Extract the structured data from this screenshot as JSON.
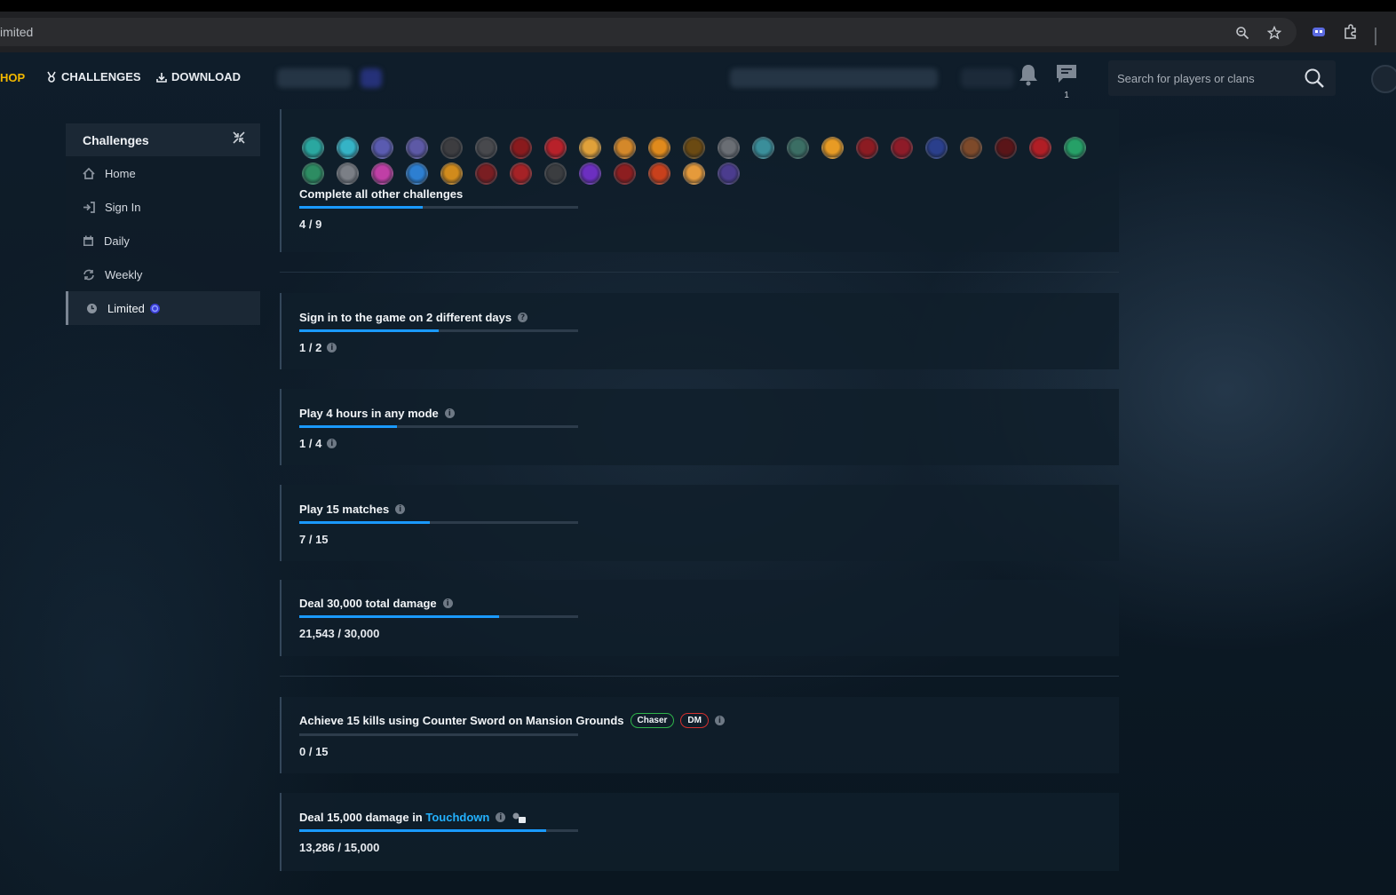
{
  "browser": {
    "url_fragment": "imited"
  },
  "nav": {
    "shop": "HOP",
    "challenges": "CHALLENGES",
    "download": "DOWNLOAD",
    "message_count": "1",
    "search_placeholder": "Search for players or clans"
  },
  "sidebar": {
    "title": "Challenges",
    "items": [
      {
        "label": "Home",
        "icon": "home-icon"
      },
      {
        "label": "Sign In",
        "icon": "sign-in-icon"
      },
      {
        "label": "Daily",
        "icon": "calendar-icon"
      },
      {
        "label": "Weekly",
        "icon": "refresh-icon"
      },
      {
        "label": "Limited",
        "icon": "clock-icon",
        "active": true
      }
    ]
  },
  "colors": {
    "accent": "#1a9aff",
    "shop": "#f2b800",
    "chaser": "#2fb44a",
    "dm": "#d3302e",
    "link": "#23b2ff"
  },
  "rewards": {
    "colors": [
      "#2aa7a0",
      "#35b3c6",
      "#5a5bb0",
      "#5d59a6",
      "#3d3d40",
      "#48494d",
      "#8a1a1d",
      "#b8212a",
      "#e0a13a",
      "#d4882a",
      "#e08a1c",
      "#6b4a12",
      "#6a6e74",
      "#3a8e9a",
      "#3b6e64",
      "#e89b24",
      "#8c1b22",
      "#8e1b28",
      "#2a3f8c",
      "#7e4a2a",
      "#5a1518",
      "#b11e25",
      "#26a067",
      "#2d8c62",
      "#7b7f86",
      "#c03fa6",
      "#2d7fd1",
      "#d18b1c",
      "#7a1e22",
      "#a52226",
      "#3b3d40",
      "#6c2fc0",
      "#8d1e20",
      "#c8401c",
      "#e59a3b",
      "#4b3c8e"
    ]
  },
  "challenges": [
    {
      "title": "Complete all other challenges",
      "progress": "4 / 9",
      "fraction": 0.444
    },
    {
      "title": "Sign in to the game on 2 different days",
      "progress": "1 / 2",
      "fraction": 0.5
    },
    {
      "title": "Play 4 hours in any mode",
      "progress": "1 / 4",
      "fraction": 0.35
    },
    {
      "title": "Play 15 matches",
      "progress": "7 / 15",
      "fraction": 0.467
    },
    {
      "title": "Deal 30,000 total damage",
      "progress": "21,543 / 30,000",
      "fraction": 0.718
    },
    {
      "title": "Achieve 15 kills using Counter Sword on Mansion Grounds",
      "progress": "0 / 15",
      "fraction": 0,
      "tags": [
        "Chaser",
        "DM"
      ]
    },
    {
      "title": "Deal 15,000 damage in",
      "title_link": "Touchdown",
      "progress": "13,286 / 15,000",
      "fraction": 0.886
    }
  ]
}
